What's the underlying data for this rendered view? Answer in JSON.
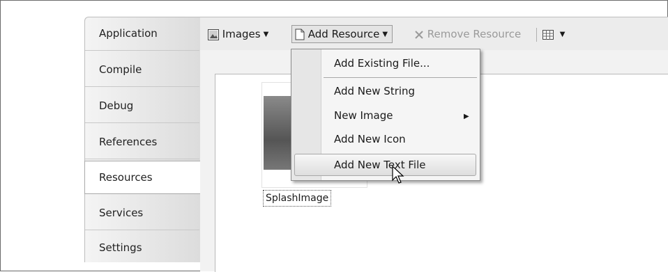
{
  "sidebar": {
    "tabs": [
      "Application",
      "Compile",
      "Debug",
      "References",
      "Resources",
      "Services",
      "Settings"
    ],
    "active": "Resources"
  },
  "toolbar": {
    "images_label": "Images",
    "add_resource_label": "Add Resource",
    "remove_resource_label": "Remove Resource"
  },
  "resource": {
    "caption": "SplashImage"
  },
  "menu": {
    "items": [
      "Add Existing File...",
      "Add New String",
      "New Image",
      "Add New Icon",
      "Add New Text File"
    ],
    "highlighted": "Add New Text File"
  }
}
